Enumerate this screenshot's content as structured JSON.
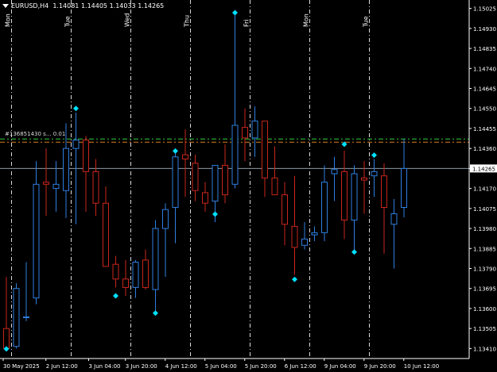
{
  "header": {
    "symbol_timeframe": "EURUSD,H4",
    "ohlc": "1.14081 1.14405 1.14033 1.14265"
  },
  "trade_label": "#136851430 s... 0.01",
  "day_markers": [
    "Mon",
    "Tue",
    "Wed",
    "Thu",
    "Fri",
    "Mon",
    "Tue"
  ],
  "price_axis": {
    "labels": [
      "1.15025",
      "1.14930",
      "1.14835",
      "1.14740",
      "1.14645",
      "1.14550",
      "1.14455",
      "1.14360",
      "1.14265",
      "1.14170",
      "1.14075",
      "1.13980",
      "1.13885",
      "1.13790",
      "1.13695",
      "1.13600",
      "1.13505",
      "1.13410"
    ],
    "current_price": "1.14265"
  },
  "time_axis": {
    "labels": [
      "30 May 2025",
      "2 Jun 12:00",
      "3 Jun 04:00",
      "3 Jun 20:00",
      "4 Jun 12:00",
      "5 Jun 04:00",
      "5 Jun 20:00",
      "6 Jun 12:00",
      "9 Jun 04:00",
      "9 Jun 20:00",
      "10 Jun 12:00"
    ]
  },
  "colors": {
    "background": "#000000",
    "bull": "#2f7fe0",
    "bear": "#c8261c",
    "marker": "#00e0ff",
    "grid": "#ffffff",
    "current_line": "#8a9aa6",
    "trade_line_green": "#2ecc40",
    "trade_line_orange": "#d98020"
  },
  "chart_data": {
    "type": "candlestick",
    "title": "EURUSD,H4",
    "ylim": [
      1.1337,
      1.1505
    ],
    "trade_levels": [
      1.14405,
      1.1439
    ],
    "current_price": 1.14265,
    "candles": [
      {
        "o": 1.13505,
        "h": 1.1375,
        "l": 1.1344,
        "c": 1.1341
      },
      {
        "o": 1.1342,
        "h": 1.1372,
        "l": 1.1341,
        "c": 1.13695
      },
      {
        "o": 1.1356,
        "h": 1.1382,
        "l": 1.1354,
        "c": 1.1356
      },
      {
        "o": 1.1365,
        "h": 1.143,
        "l": 1.1362,
        "c": 1.1419
      },
      {
        "o": 1.142,
        "h": 1.1436,
        "l": 1.1404,
        "c": 1.1419
      },
      {
        "o": 1.1417,
        "h": 1.143,
        "l": 1.1406,
        "c": 1.1419
      },
      {
        "o": 1.1416,
        "h": 1.1448,
        "l": 1.1403,
        "c": 1.1436
      },
      {
        "o": 1.1436,
        "h": 1.1453,
        "l": 1.14,
        "c": 1.144
      },
      {
        "o": 1.144,
        "h": 1.1442,
        "l": 1.1406,
        "c": 1.1425
      },
      {
        "o": 1.1425,
        "h": 1.1431,
        "l": 1.1404,
        "c": 1.141
      },
      {
        "o": 1.141,
        "h": 1.1418,
        "l": 1.1381,
        "c": 1.138
      },
      {
        "o": 1.1381,
        "h": 1.1385,
        "l": 1.137,
        "c": 1.1374
      },
      {
        "o": 1.1374,
        "h": 1.1383,
        "l": 1.1366,
        "c": 1.137
      },
      {
        "o": 1.137,
        "h": 1.1383,
        "l": 1.1365,
        "c": 1.1382
      },
      {
        "o": 1.1383,
        "h": 1.1388,
        "l": 1.1369,
        "c": 1.137
      },
      {
        "o": 1.1369,
        "h": 1.1402,
        "l": 1.1359,
        "c": 1.1398
      },
      {
        "o": 1.1398,
        "h": 1.141,
        "l": 1.1375,
        "c": 1.1407
      },
      {
        "o": 1.1408,
        "h": 1.1434,
        "l": 1.1391,
        "c": 1.1432
      },
      {
        "o": 1.1433,
        "h": 1.1445,
        "l": 1.1413,
        "c": 1.1431
      },
      {
        "o": 1.1429,
        "h": 1.1433,
        "l": 1.1411,
        "c": 1.1416
      },
      {
        "o": 1.1415,
        "h": 1.142,
        "l": 1.1406,
        "c": 1.141
      },
      {
        "o": 1.1411,
        "h": 1.1428,
        "l": 1.1401,
        "c": 1.1428
      },
      {
        "o": 1.1428,
        "h": 1.1438,
        "l": 1.141,
        "c": 1.1414
      },
      {
        "o": 1.1419,
        "h": 1.15,
        "l": 1.1417,
        "c": 1.1447
      },
      {
        "o": 1.1446,
        "h": 1.1455,
        "l": 1.143,
        "c": 1.1441
      },
      {
        "o": 1.1441,
        "h": 1.1456,
        "l": 1.1432,
        "c": 1.1449
      },
      {
        "o": 1.1449,
        "h": 1.1449,
        "l": 1.1413,
        "c": 1.1422
      },
      {
        "o": 1.1422,
        "h": 1.1437,
        "l": 1.1414,
        "c": 1.1414
      },
      {
        "o": 1.1414,
        "h": 1.142,
        "l": 1.139,
        "c": 1.14
      },
      {
        "o": 1.1399,
        "h": 1.1423,
        "l": 1.1376,
        "c": 1.1389
      },
      {
        "o": 1.139,
        "h": 1.1401,
        "l": 1.1388,
        "c": 1.1393
      },
      {
        "o": 1.1395,
        "h": 1.1399,
        "l": 1.1392,
        "c": 1.1396
      },
      {
        "o": 1.1396,
        "h": 1.1428,
        "l": 1.1392,
        "c": 1.142
      },
      {
        "o": 1.1424,
        "h": 1.1432,
        "l": 1.1411,
        "c": 1.1426
      },
      {
        "o": 1.1425,
        "h": 1.1435,
        "l": 1.1393,
        "c": 1.1402
      },
      {
        "o": 1.1402,
        "h": 1.1428,
        "l": 1.1388,
        "c": 1.1424
      },
      {
        "o": 1.1422,
        "h": 1.143,
        "l": 1.1405,
        "c": 1.1421
      },
      {
        "o": 1.1423,
        "h": 1.1431,
        "l": 1.1413,
        "c": 1.1425
      },
      {
        "o": 1.1423,
        "h": 1.1429,
        "l": 1.1386,
        "c": 1.1408
      },
      {
        "o": 1.14,
        "h": 1.1412,
        "l": 1.1379,
        "c": 1.1405
      },
      {
        "o": 1.1408,
        "h": 1.14405,
        "l": 1.14033,
        "c": 1.14265
      }
    ],
    "markers": [
      {
        "i": 0,
        "p": 1.13408
      },
      {
        "i": 7,
        "p": 1.1455
      },
      {
        "i": 11,
        "p": 1.1366
      },
      {
        "i": 15,
        "p": 1.13578
      },
      {
        "i": 17,
        "p": 1.14348
      },
      {
        "i": 21,
        "p": 1.14048
      },
      {
        "i": 23,
        "p": 1.15005
      },
      {
        "i": 29,
        "p": 1.13738
      },
      {
        "i": 34,
        "p": 1.1438
      },
      {
        "i": 35,
        "p": 1.13868
      },
      {
        "i": 37,
        "p": 1.14328
      }
    ]
  }
}
